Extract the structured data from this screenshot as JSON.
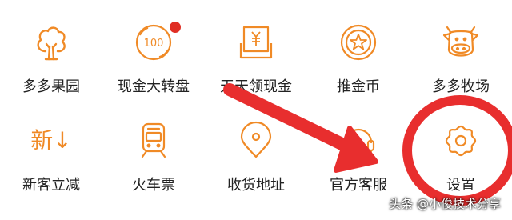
{
  "theme": {
    "icon_color": "#f08a26",
    "badge_color": "#e02e24",
    "annotation_color": "#e82e2e",
    "label_color": "#222222"
  },
  "grid": {
    "row1": [
      {
        "label": "多多果园",
        "icon": "tree-icon"
      },
      {
        "label": "现金大转盘",
        "icon": "wheel-100-icon",
        "badge": true
      },
      {
        "label": "天天领现金",
        "icon": "cash-envelope-icon"
      },
      {
        "label": "推金币",
        "icon": "coin-icon"
      },
      {
        "label": "多多牧场",
        "icon": "cow-icon"
      }
    ],
    "row2": [
      {
        "label": "新客立减",
        "icon": "new-arrow-icon",
        "icon_text": "新↓"
      },
      {
        "label": "火车票",
        "icon": "train-icon"
      },
      {
        "label": "收货地址",
        "icon": "location-pin-icon"
      },
      {
        "label": "官方客服",
        "icon": "headset-icon"
      },
      {
        "label": "设置",
        "icon": "gear-icon"
      }
    ]
  },
  "watermark": {
    "text": "头条 @小俊技术分享"
  }
}
